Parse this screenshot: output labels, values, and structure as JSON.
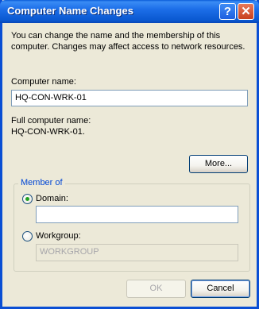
{
  "window": {
    "title": "Computer Name Changes",
    "help_glyph": "?",
    "close_glyph": "✕"
  },
  "intro": {
    "line1": "You can change the name and the membership of this",
    "line2": "computer. Changes may affect access to network resources."
  },
  "computer_name": {
    "label": "Computer name:",
    "value": "HQ-CON-WRK-01"
  },
  "full_name": {
    "label": "Full computer name:",
    "value": "HQ-CON-WRK-01."
  },
  "more_button": "More...",
  "member_of": {
    "label": "Member of",
    "selected": "domain",
    "domain_label": "Domain:",
    "domain_value": "",
    "workgroup_label": "Workgroup:",
    "workgroup_value": "WORKGROUP"
  },
  "buttons": {
    "ok": "OK",
    "cancel": "Cancel"
  },
  "icons": {
    "help": "help-icon",
    "close": "close-icon",
    "domain_radio": "radio-checked",
    "workgroup_radio": "radio-unchecked"
  }
}
